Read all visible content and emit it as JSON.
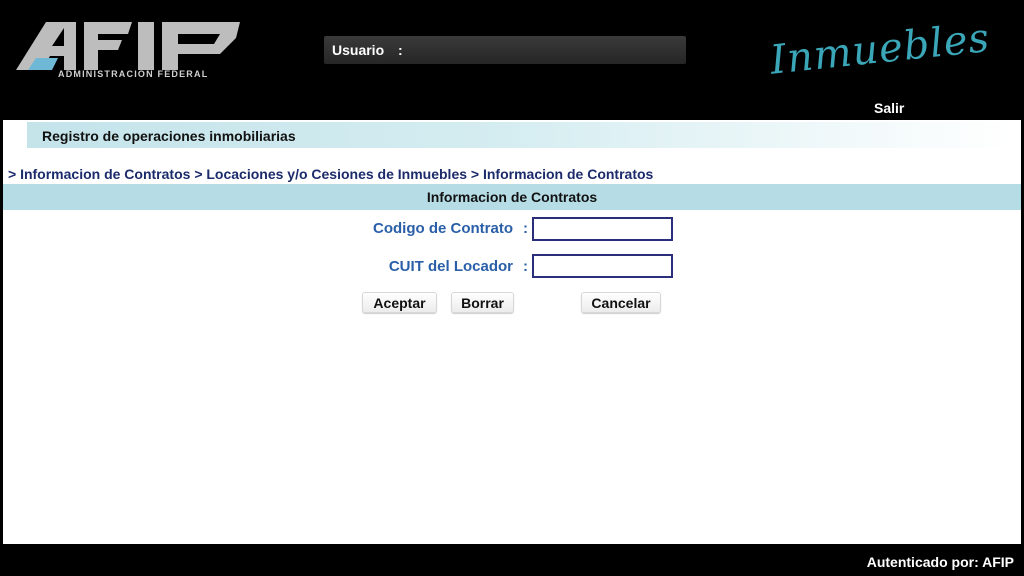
{
  "header": {
    "logo_text": "AFIP",
    "logo_subtitle": "ADMINISTRACION FEDERAL",
    "user_label": "Usuario",
    "user_separator": ":",
    "user_value": "",
    "brand_text": "Inmuebles",
    "logout_label": "Salir"
  },
  "page": {
    "title": "Registro de operaciones inmobiliarias",
    "breadcrumb": [
      "> Informacion de Contratos",
      "> Locaciones y/o Cesiones de Inmuebles",
      "> Informacion de Contratos"
    ],
    "section_title": "Informacion de Contratos"
  },
  "form": {
    "contract_code_label": "Codigo de Contrato",
    "contract_code_value": "",
    "cuit_label": "CUIT del Locador",
    "cuit_value": "",
    "separator": ":"
  },
  "buttons": {
    "accept": "Aceptar",
    "clear": "Borrar",
    "cancel": "Cancelar"
  },
  "footer": {
    "auth_text": "Autenticado por: AFIP"
  },
  "colors": {
    "header_bg": "#000000",
    "section_bg": "#b6dde6",
    "label_blue": "#2a5fa8",
    "breadcrumb_navy": "#1c2b6b",
    "brand_teal": "#3aa6b8"
  }
}
